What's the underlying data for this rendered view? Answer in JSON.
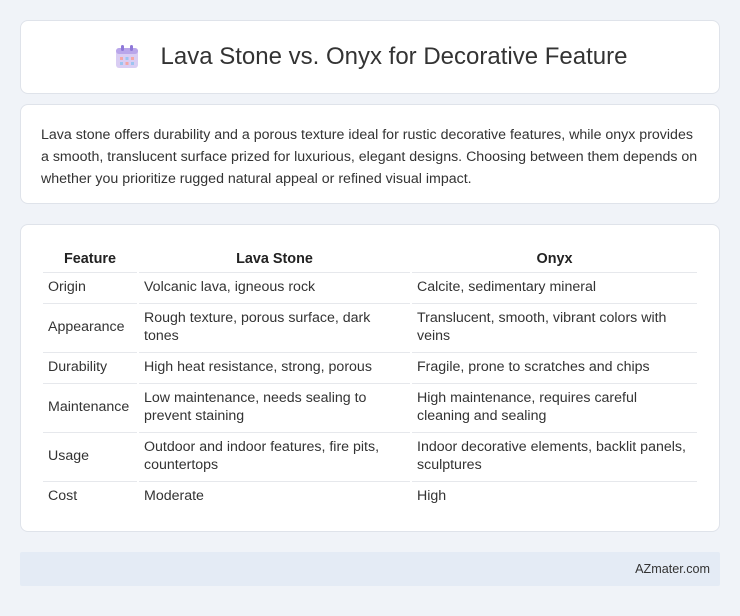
{
  "header": {
    "title": "Lava Stone vs. Onyx for Decorative Feature",
    "icon": "calendar-icon"
  },
  "summary": {
    "text": "Lava stone offers durability and a porous texture ideal for rustic decorative features, while onyx provides a smooth, translucent surface prized for luxurious, elegant designs. Choosing between them depends on whether you prioritize rugged natural appeal or refined visual impact."
  },
  "table": {
    "headers": [
      "Feature",
      "Lava Stone",
      "Onyx"
    ],
    "rows": [
      [
        "Origin",
        "Volcanic lava, igneous rock",
        "Calcite, sedimentary mineral"
      ],
      [
        "Appearance",
        "Rough texture, porous surface, dark tones",
        "Translucent, smooth, vibrant colors with veins"
      ],
      [
        "Durability",
        "High heat resistance, strong, porous",
        "Fragile, prone to scratches and chips"
      ],
      [
        "Maintenance",
        "Low maintenance, needs sealing to prevent staining",
        "High maintenance, requires careful cleaning and sealing"
      ],
      [
        "Usage",
        "Outdoor and indoor features, fire pits, countertops",
        "Indoor decorative elements, backlit panels, sculptures"
      ],
      [
        "Cost",
        "Moderate",
        "High"
      ]
    ]
  },
  "footer": {
    "brand": "AZmater.com"
  }
}
